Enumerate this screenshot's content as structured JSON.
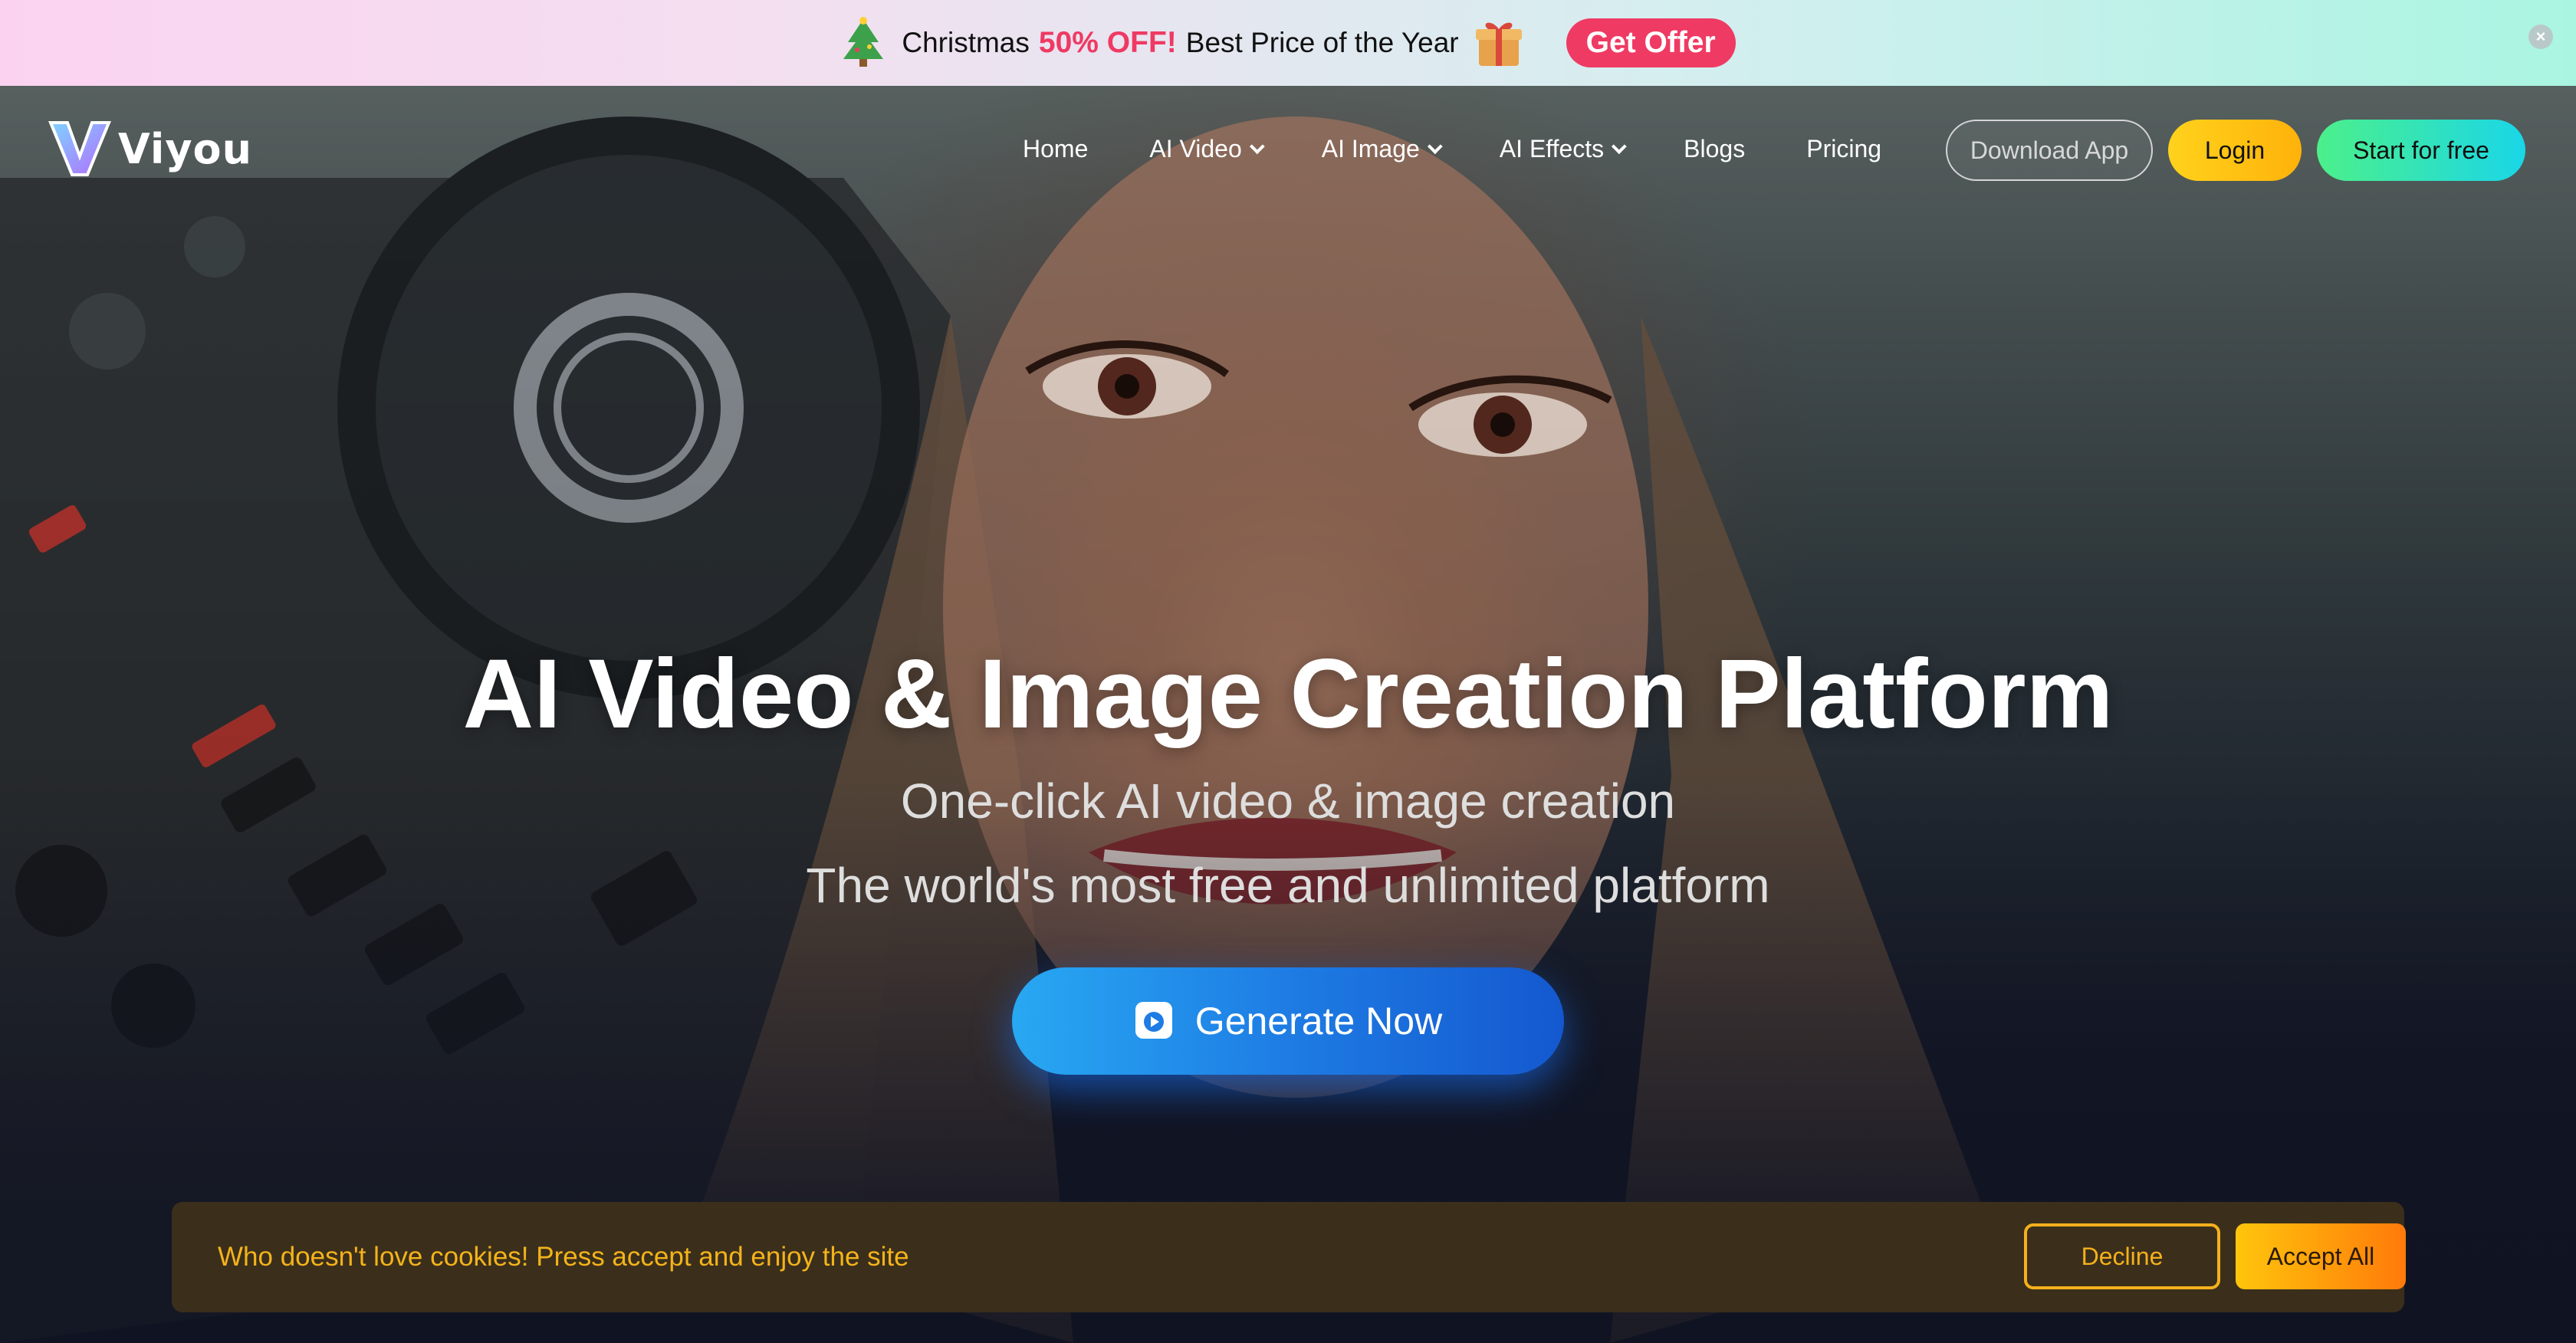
{
  "promo": {
    "text_before": "Christmas",
    "highlight": "50% OFF!",
    "text_after": "Best Price of the Year",
    "offer_button": "Get Offer",
    "close_glyph": "×",
    "icons": [
      "christmas-tree-icon",
      "gift-box-icon",
      "close-icon"
    ],
    "highlight_color": "#ef3a63"
  },
  "nav": {
    "logo_text": "Viyou",
    "links": [
      {
        "label": "Home",
        "has_dropdown": false
      },
      {
        "label": "AI Video",
        "has_dropdown": true
      },
      {
        "label": "AI Image",
        "has_dropdown": true
      },
      {
        "label": "AI Effects",
        "has_dropdown": true
      },
      {
        "label": "Blogs",
        "has_dropdown": false
      },
      {
        "label": "Pricing",
        "has_dropdown": false
      }
    ],
    "download_app": "Download App",
    "login": "Login",
    "start_free": "Start for free"
  },
  "hero": {
    "title": "AI Video & Image Creation Platform",
    "subtitle_1": "One-click AI video & image creation",
    "subtitle_2": "The world's most free and unlimited platform",
    "generate_button": "Generate Now",
    "generate_icon": "video-play-icon"
  },
  "cookie": {
    "message": "Who doesn't love cookies! Press accept and enjoy the site",
    "decline": "Decline",
    "accept": "Accept All",
    "accent_color": "#f5b01c"
  }
}
